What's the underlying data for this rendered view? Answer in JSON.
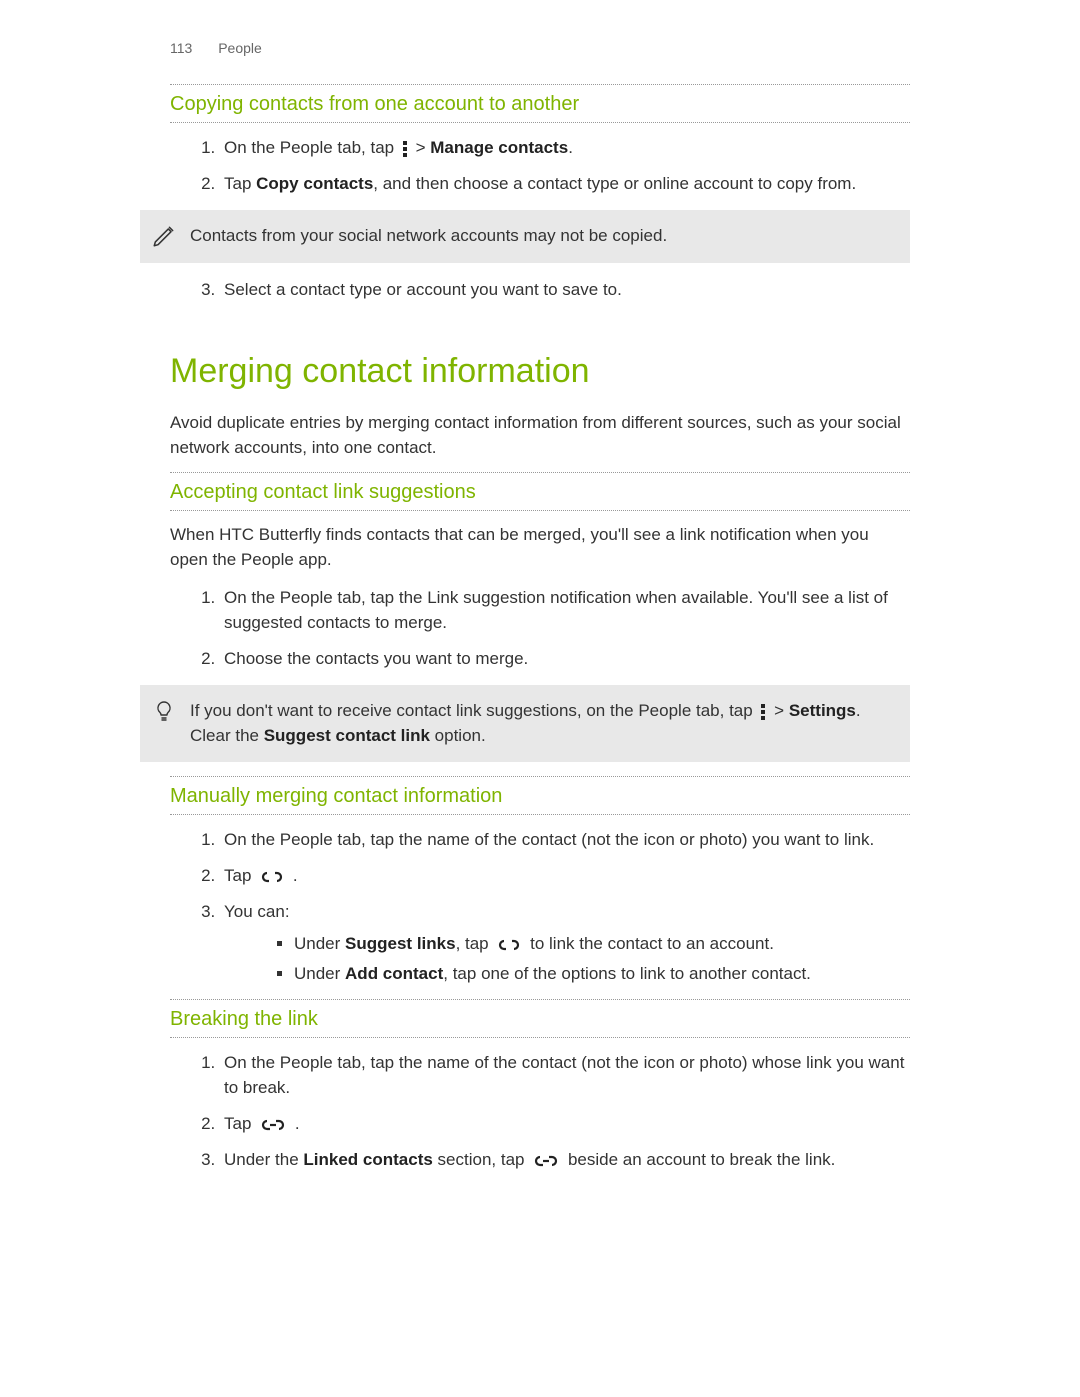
{
  "header": {
    "page_number": "113",
    "section": "People"
  },
  "copying": {
    "title": "Copying contacts from one account to another",
    "step1_a": "On the People tab, tap ",
    "step1_b": " > ",
    "step1_c": "Manage contacts",
    "step1_d": ".",
    "step2_a": "Tap ",
    "step2_b": "Copy contacts",
    "step2_c": ", and then choose a contact type or online account to copy from.",
    "note": "Contacts from your social network accounts may not be copied.",
    "step3": "Select a contact type or account you want to save to."
  },
  "merging": {
    "title": "Merging contact information",
    "intro": "Avoid duplicate entries by merging contact information from different sources, such as your social network accounts, into one contact."
  },
  "accepting": {
    "title": "Accepting contact link suggestions",
    "intro": "When HTC Butterfly finds contacts that can be merged, you'll see a link notification when you open the People app.",
    "step1": "On the People tab, tap the Link suggestion notification when available. You'll see a list of suggested contacts to merge.",
    "step2": "Choose the contacts you want to merge.",
    "tip_a": "If you don't want to receive contact link suggestions, on the People tab, tap ",
    "tip_b": " > ",
    "tip_c": "Settings",
    "tip_d": ". Clear the ",
    "tip_e": "Suggest contact link",
    "tip_f": " option."
  },
  "manual": {
    "title": "Manually merging contact information",
    "step1": "On the People tab, tap the name of the contact (not the icon or photo) you want to link.",
    "step2_a": "Tap ",
    "step2_b": " .",
    "step3": "You can:",
    "bullet1_a": "Under ",
    "bullet1_b": "Suggest links",
    "bullet1_c": ", tap ",
    "bullet1_d": " to link the contact to an account.",
    "bullet2_a": "Under ",
    "bullet2_b": "Add contact",
    "bullet2_c": ", tap one of the options to link to another contact."
  },
  "breaking": {
    "title": "Breaking the link",
    "step1": "On the People tab, tap the name of the contact (not the icon or photo) whose link you want to break.",
    "step2_a": "Tap ",
    "step2_b": " .",
    "step3_a": "Under the ",
    "step3_b": "Linked contacts",
    "step3_c": " section, tap ",
    "step3_d": " beside an account to break the link."
  }
}
